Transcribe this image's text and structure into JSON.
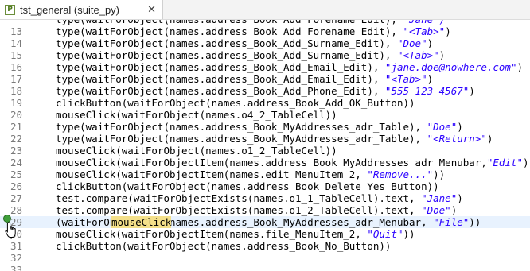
{
  "tab": {
    "icon_label": "P",
    "title": "tst_general (suite_py)",
    "close": "✕"
  },
  "editor": {
    "current_line": 29,
    "lines": [
      {
        "num": "",
        "parts": [
          {
            "t": "type(waitForObject(names.address_Book_Add_Forename_Edit), ",
            "c": "code"
          },
          {
            "t": "\"Jane\")",
            "c": "str"
          }
        ]
      },
      {
        "num": "13",
        "parts": [
          {
            "t": "type(waitForObject(names.address_Book_Add_Forename_Edit), ",
            "c": "code"
          },
          {
            "t": "\"<Tab>\"",
            "c": "str"
          },
          {
            "t": ")",
            "c": "code"
          }
        ]
      },
      {
        "num": "14",
        "parts": [
          {
            "t": "type(waitForObject(names.address_Book_Add_Surname_Edit), ",
            "c": "code"
          },
          {
            "t": "\"Doe\"",
            "c": "str"
          },
          {
            "t": ")",
            "c": "code"
          }
        ]
      },
      {
        "num": "15",
        "parts": [
          {
            "t": "type(waitForObject(names.address_Book_Add_Surname_Edit), ",
            "c": "code"
          },
          {
            "t": "\"<Tab>\"",
            "c": "str"
          },
          {
            "t": ")",
            "c": "code"
          }
        ]
      },
      {
        "num": "16",
        "parts": [
          {
            "t": "type(waitForObject(names.address_Book_Add_Email_Edit), ",
            "c": "code"
          },
          {
            "t": "\"jane.doe@nowhere.com\"",
            "c": "str"
          },
          {
            "t": ")",
            "c": "code"
          }
        ]
      },
      {
        "num": "17",
        "parts": [
          {
            "t": "type(waitForObject(names.address_Book_Add_Email_Edit), ",
            "c": "code"
          },
          {
            "t": "\"<Tab>\"",
            "c": "str"
          },
          {
            "t": ")",
            "c": "code"
          }
        ]
      },
      {
        "num": "18",
        "parts": [
          {
            "t": "type(waitForObject(names.address_Book_Add_Phone_Edit), ",
            "c": "code"
          },
          {
            "t": "\"555 123 4567\"",
            "c": "str"
          },
          {
            "t": ")",
            "c": "code"
          }
        ]
      },
      {
        "num": "19",
        "parts": [
          {
            "t": "clickButton(waitForObject(names.address_Book_Add_OK_Button))",
            "c": "code"
          }
        ]
      },
      {
        "num": "20",
        "parts": [
          {
            "t": "mouseClick(waitForObject(names.o4_2_TableCell))",
            "c": "code"
          }
        ]
      },
      {
        "num": "21",
        "parts": [
          {
            "t": "type(waitForObject(names.address_Book_MyAddresses_adr_Table), ",
            "c": "code"
          },
          {
            "t": "\"Doe\"",
            "c": "str"
          },
          {
            "t": ")",
            "c": "code"
          }
        ]
      },
      {
        "num": "22",
        "parts": [
          {
            "t": "type(waitForObject(names.address_Book_MyAddresses_adr_Table), ",
            "c": "code"
          },
          {
            "t": "\"<Return>\"",
            "c": "str"
          },
          {
            "t": ")",
            "c": "code"
          }
        ]
      },
      {
        "num": "23",
        "parts": [
          {
            "t": "mouseClick(waitForObject(names.o1_2_TableCell))",
            "c": "code"
          }
        ]
      },
      {
        "num": "24",
        "parts": [
          {
            "t": "mouseClick(waitForObjectItem(names.address_Book_MyAddresses_adr_Menubar,",
            "c": "code"
          },
          {
            "t": "\"Edit\"",
            "c": "str"
          },
          {
            "t": "))",
            "c": "code"
          }
        ]
      },
      {
        "num": "25",
        "parts": [
          {
            "t": "mouseClick(waitForObjectItem(names.edit_MenuItem_2, ",
            "c": "code"
          },
          {
            "t": "\"Remove...\"",
            "c": "str"
          },
          {
            "t": "))",
            "c": "code"
          }
        ]
      },
      {
        "num": "26",
        "parts": [
          {
            "t": "clickButton(waitForObject(names.address_Book_Delete_Yes_Button))",
            "c": "code"
          }
        ]
      },
      {
        "num": "27",
        "parts": [
          {
            "t": "test.compare(waitForObjectExists(names.o1_1_TableCell).text, ",
            "c": "code"
          },
          {
            "t": "\"Jane\"",
            "c": "str"
          },
          {
            "t": ")",
            "c": "code"
          }
        ]
      },
      {
        "num": "28",
        "parts": [
          {
            "t": "test.compare(waitForObjectExists(names.o1_2_TableCell).text, ",
            "c": "code"
          },
          {
            "t": "\"Doe\"",
            "c": "str"
          },
          {
            "t": ")",
            "c": "code"
          }
        ]
      },
      {
        "num": "29",
        "parts": [
          {
            "t": "mouseClick",
            "c": "code tok-hl"
          },
          {
            "t": "(waitForObjectItem(names.address_Book_MyAddresses_adr_Menubar, ",
            "c": "code"
          },
          {
            "t": "\"File\"",
            "c": "str"
          },
          {
            "t": "))",
            "c": "code"
          }
        ]
      },
      {
        "num": "30",
        "parts": [
          {
            "t": "mouseClick(waitForObjectItem(names.file_MenuItem_2, ",
            "c": "code"
          },
          {
            "t": "\"Quit\"",
            "c": "str"
          },
          {
            "t": "))",
            "c": "code"
          }
        ]
      },
      {
        "num": "31",
        "parts": [
          {
            "t": "clickButton(waitForObject(names.address_Book_No_Button))",
            "c": "code"
          }
        ]
      },
      {
        "num": "32",
        "parts": []
      },
      {
        "num": "33",
        "parts": []
      }
    ]
  }
}
